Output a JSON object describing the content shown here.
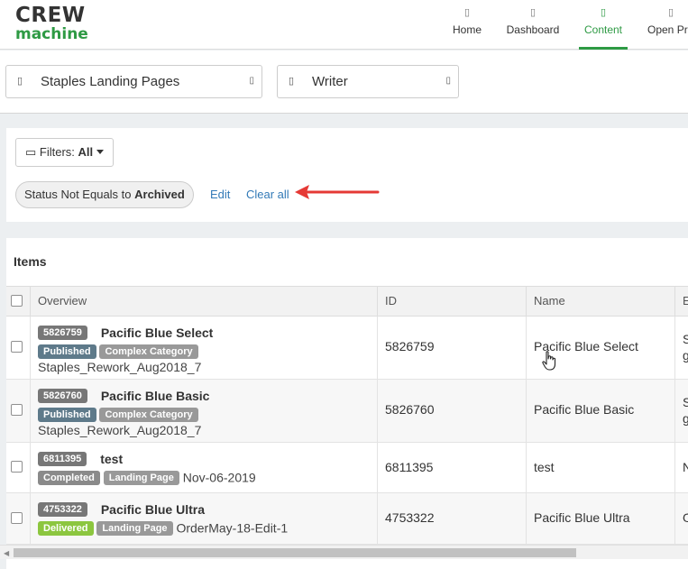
{
  "header": {
    "logo_line1": "CREW",
    "logo_line2": "machine",
    "nav": [
      {
        "label": "Home",
        "icon": "home-icon"
      },
      {
        "label": "Dashboard",
        "icon": "dashboard-icon"
      },
      {
        "label": "Content",
        "icon": "content-icon",
        "active": true
      },
      {
        "label": "Open Pr",
        "icon": "projects-icon"
      }
    ]
  },
  "selectors": {
    "project": "Staples Landing Pages",
    "role": "Writer"
  },
  "filters": {
    "button_label": "Filters:",
    "button_value": "All",
    "chip_text": "Status Not Equals to ",
    "chip_bold": "Archived",
    "edit_label": "Edit",
    "clear_label": "Clear all"
  },
  "items": {
    "title": "Items",
    "columns": [
      "Overview",
      "ID",
      "Name",
      "E"
    ],
    "rows": [
      {
        "id": "5826759",
        "title": "Pacific Blue Select",
        "status": "Published",
        "category": "Complex Category",
        "line3": "Staples_Rework_Aug2018_7",
        "name": "Pacific Blue Select",
        "extra": "S\ng"
      },
      {
        "id": "5826760",
        "title": "Pacific Blue Basic",
        "status": "Published",
        "category": "Complex Category",
        "line3": "Staples_Rework_Aug2018_7",
        "name": "Pacific Blue Basic",
        "extra": "S\ng"
      },
      {
        "id": "6811395",
        "title": "test",
        "status": "Completed",
        "category": "Landing Page",
        "trail": "Nov-06-2019",
        "name": "test",
        "extra": "N"
      },
      {
        "id": "4753322",
        "title": "Pacific Blue Ultra",
        "status": "Delivered",
        "category": "Landing Page",
        "trail": "OrderMay-18-Edit-1",
        "name": "Pacific Blue Ultra",
        "extra": "O"
      }
    ]
  },
  "colors": {
    "brand_green": "#2e9a44",
    "link_blue": "#337ab7",
    "published": "#5e7a8a",
    "delivered": "#8cc63f",
    "annotation_arrow": "#e53935"
  }
}
